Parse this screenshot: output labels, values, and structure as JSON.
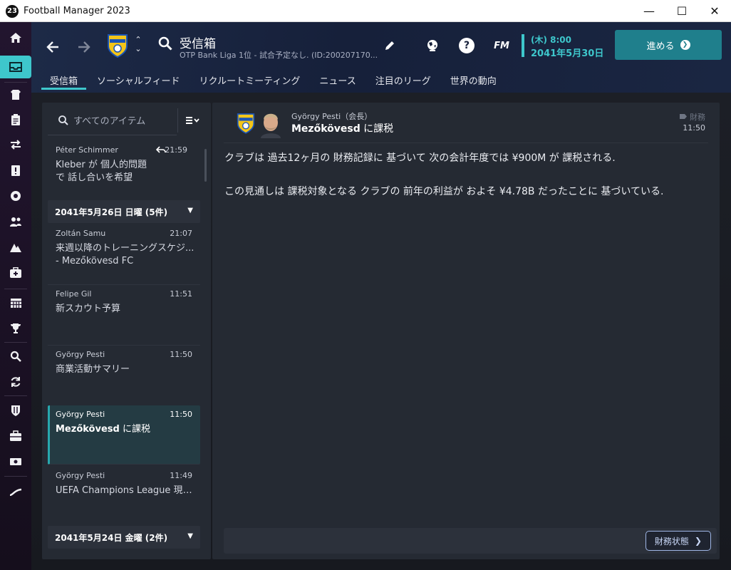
{
  "window": {
    "badge": "23",
    "title": "Football Manager 2023",
    "minimize": "—",
    "maximize": "☐",
    "close": "✕"
  },
  "header": {
    "title": "受信箱",
    "subtitle": "OTP Bank Liga 1位 - 試合予定なし. (ID:200207170...",
    "day_time": "(木) 8:00",
    "date": "2041年5月30日",
    "continue_label": "進める",
    "fm_label": "FM",
    "help_label": "?"
  },
  "tabs": [
    "受信箱",
    "ソーシャルフィード",
    "リクルートミーティング",
    "ニュース",
    "注目のリーグ",
    "世界の動向"
  ],
  "inbox": {
    "search_placeholder": "すべてのアイテム",
    "items": [
      {
        "from": "Péter Schimmer",
        "time": "21:59",
        "subject": "Kleber が 個人的問題で 話し合いを希望"
      },
      {
        "from": "Zoltán Samu",
        "time": "21:07",
        "subject": "来週以降のトレーニングスケジ... - Mezőkövesd FC"
      },
      {
        "from": "Felipe Gil",
        "time": "11:51",
        "subject": "新スカウト予算"
      },
      {
        "from": "György Pesti",
        "time": "11:50",
        "subject": "商業活動サマリー"
      },
      {
        "from": "György Pesti",
        "time": "11:50",
        "subject_bold": "Mezőkövesd",
        "subject_rest": " に課税"
      },
      {
        "from": "György Pesti",
        "time": "11:49",
        "subject": "UEFA Champions League 現在のファイナンシャルフェア..."
      }
    ],
    "groups": [
      {
        "label": "2041年5月26日 日曜 (5件)"
      },
      {
        "label": "2041年5月24日 金曜 (2件)"
      }
    ]
  },
  "message": {
    "sender": "György Pesti（会長）",
    "subject_bold": "Mezőkövesd",
    "subject_rest": " に課税",
    "tag": "財務",
    "time": "11:50",
    "body": [
      "クラブは 過去12ヶ月の 財務記録に 基づいて 次の会計年度では ¥900M が 課税される.",
      "この見通しは 課税対象となる クラブの 前年の利益が およそ ¥4.78B だったことに 基づいている."
    ],
    "action_label": "財務状態"
  },
  "colors": {
    "accent": "#3ec7cc",
    "continue_bg": "#1f7f8c",
    "selected_row": "#243b43"
  },
  "icons": [
    "home-icon",
    "inbox-icon",
    "squad-icon",
    "clipboard-icon",
    "transfer-icon",
    "report-icon",
    "ball-icon",
    "staff-icon",
    "training-icon",
    "medical-icon",
    "calendar-icon",
    "trophy-icon",
    "scout-icon",
    "recruit-icon",
    "club-icon",
    "finance-icon",
    "money-icon",
    "dev-icon"
  ]
}
